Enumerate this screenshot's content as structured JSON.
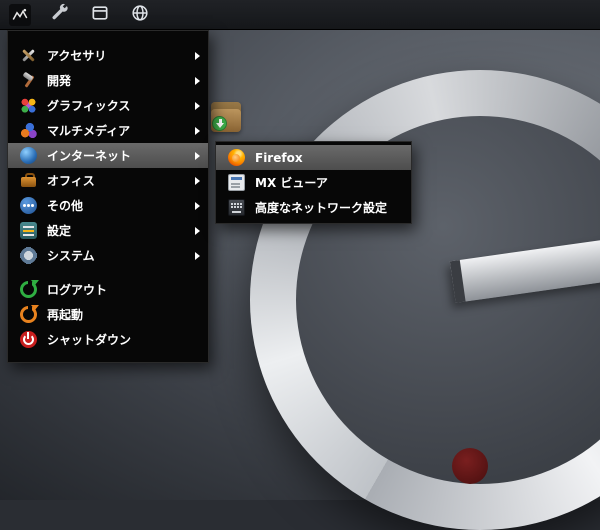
{
  "taskbar": {
    "buttons": [
      {
        "name": "menu-logo"
      },
      {
        "name": "tools"
      },
      {
        "name": "window"
      },
      {
        "name": "globe"
      }
    ]
  },
  "menu": {
    "categories": [
      {
        "label": "アクセサリ",
        "icon": "accessories-icon",
        "has_submenu": true,
        "highlighted": false
      },
      {
        "label": "開発",
        "icon": "development-icon",
        "has_submenu": true,
        "highlighted": false
      },
      {
        "label": "グラフィックス",
        "icon": "graphics-icon",
        "has_submenu": true,
        "highlighted": false
      },
      {
        "label": "マルチメディア",
        "icon": "multimedia-icon",
        "has_submenu": true,
        "highlighted": false
      },
      {
        "label": "インターネット",
        "icon": "internet-icon",
        "has_submenu": true,
        "highlighted": true
      },
      {
        "label": "オフィス",
        "icon": "office-icon",
        "has_submenu": true,
        "highlighted": false
      },
      {
        "label": "その他",
        "icon": "other-icon",
        "has_submenu": true,
        "highlighted": false
      },
      {
        "label": "設定",
        "icon": "settings-icon",
        "has_submenu": true,
        "highlighted": false
      },
      {
        "label": "システム",
        "icon": "system-icon",
        "has_submenu": true,
        "highlighted": false
      }
    ],
    "actions": [
      {
        "label": "ログアウト",
        "icon": "logout-icon"
      },
      {
        "label": "再起動",
        "icon": "restart-icon"
      },
      {
        "label": "シャットダウン",
        "icon": "shutdown-icon"
      }
    ]
  },
  "submenu": {
    "parent": "インターネット",
    "items": [
      {
        "label": "Firefox",
        "icon": "firefox-icon",
        "highlighted": true
      },
      {
        "label": "MX ビューア",
        "icon": "viewer-icon",
        "highlighted": false
      },
      {
        "label": "高度なネットワーク設定",
        "icon": "network-icon",
        "highlighted": false
      }
    ]
  },
  "desktop": {
    "installer_icon": "installer-package-icon"
  },
  "colors": {
    "menu_background": "#070707",
    "highlight": "#5a5a5a",
    "taskbar_background": "#17181a",
    "text": "#ffffff"
  }
}
